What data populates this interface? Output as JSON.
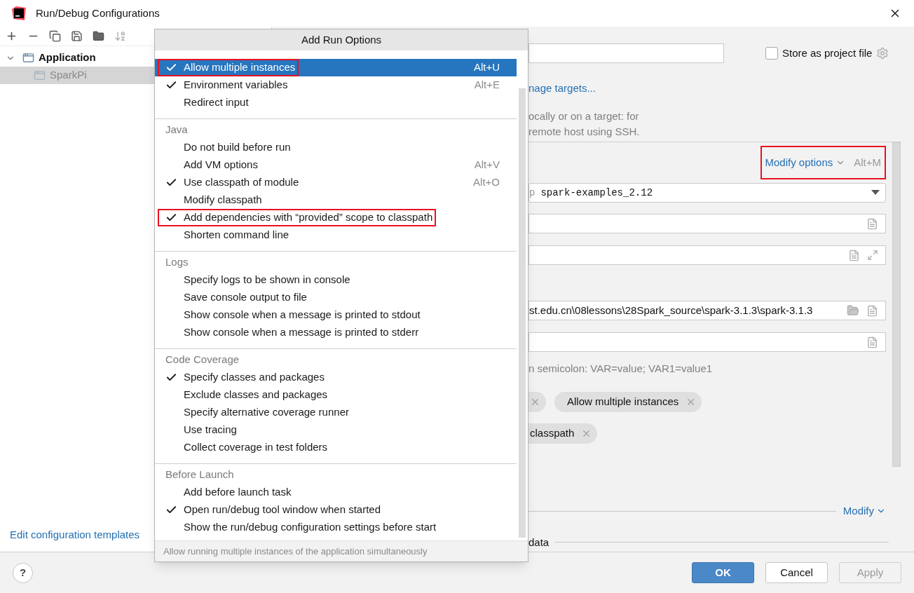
{
  "window": {
    "title": "Run/Debug Configurations"
  },
  "left_panel": {
    "tree": [
      {
        "label": "Application",
        "expanded": true,
        "selected": false,
        "children": [
          {
            "label": "SparkPi",
            "selected": true
          }
        ]
      }
    ],
    "templates_link": "Edit configuration templates"
  },
  "popup": {
    "title": "Add Run Options",
    "sections": [
      {
        "items": [
          {
            "label": "Allow multiple instances",
            "checked": true,
            "selected": true,
            "highlighted": true,
            "shortcut": "Alt+U"
          },
          {
            "label": "Environment variables",
            "checked": true,
            "selected": false,
            "highlighted": false,
            "shortcut": "Alt+E"
          },
          {
            "label": "Redirect input",
            "checked": false,
            "selected": false,
            "highlighted": false
          }
        ]
      },
      {
        "label": "Java",
        "items": [
          {
            "label": "Do not build before run",
            "checked": false,
            "selected": false,
            "highlighted": false
          },
          {
            "label": "Add VM options",
            "checked": false,
            "selected": false,
            "highlighted": false,
            "shortcut": "Alt+V"
          },
          {
            "label": "Use classpath of module",
            "checked": true,
            "selected": false,
            "highlighted": false,
            "shortcut": "Alt+O"
          },
          {
            "label": "Modify classpath",
            "checked": false,
            "selected": false,
            "highlighted": false
          },
          {
            "label": "Add dependencies with “provided” scope to classpath",
            "checked": true,
            "selected": false,
            "highlighted": true
          },
          {
            "label": "Shorten command line",
            "checked": false,
            "selected": false,
            "highlighted": false
          }
        ]
      },
      {
        "label": "Logs",
        "items": [
          {
            "label": "Specify logs to be shown in console",
            "checked": false,
            "selected": false,
            "highlighted": false
          },
          {
            "label": "Save console output to file",
            "checked": false,
            "selected": false,
            "highlighted": false
          },
          {
            "label": "Show console when a message is printed to stdout",
            "checked": false,
            "selected": false,
            "highlighted": false
          },
          {
            "label": "Show console when a message is printed to stderr",
            "checked": false,
            "selected": false,
            "highlighted": false
          }
        ]
      },
      {
        "label": "Code Coverage",
        "items": [
          {
            "label": "Specify classes and packages",
            "checked": true,
            "selected": false,
            "highlighted": false
          },
          {
            "label": "Exclude classes and packages",
            "checked": false,
            "selected": false,
            "highlighted": false
          },
          {
            "label": "Specify alternative coverage runner",
            "checked": false,
            "selected": false,
            "highlighted": false
          },
          {
            "label": "Use tracing",
            "checked": false,
            "selected": false,
            "highlighted": false
          },
          {
            "label": "Collect coverage in test folders",
            "checked": false,
            "selected": false,
            "highlighted": false
          }
        ]
      },
      {
        "label": "Before Launch",
        "items": [
          {
            "label": "Add before launch task",
            "checked": false,
            "selected": false,
            "highlighted": false
          },
          {
            "label": "Open run/debug tool window when started",
            "checked": true,
            "selected": false,
            "highlighted": false
          },
          {
            "label": "Show the run/debug configuration settings before start",
            "checked": false,
            "selected": false,
            "highlighted": false
          }
        ]
      }
    ],
    "hint": "Allow running multiple instances of the application simultaneously"
  },
  "config": {
    "store_as_project_file": {
      "label": "Store as project file",
      "checked": false
    },
    "targets_link": "nage targets...",
    "description": [
      "ocally or on a target: for",
      "remote host using SSH."
    ],
    "modify_options": {
      "label": "Modify options",
      "shortcut": "Alt+M",
      "highlighted": true
    },
    "fields": [
      {
        "kind": "combo",
        "prefix": "p",
        "value": "spark-examples_2.12"
      },
      {
        "kind": "text"
      },
      {
        "kind": "expandable"
      },
      {
        "kind": "path",
        "value": "st.edu.cn\\08lessons\\28Spark_source\\spark-3.1.3\\spark-3.1.3"
      },
      {
        "kind": "text"
      }
    ],
    "env_hint": "n semicolon: VAR=value; VAR1=value1",
    "chip_rows": [
      [
        {
          "kind": "cut"
        },
        {
          "kind": "full",
          "label": "Allow multiple instances"
        }
      ],
      [
        {
          "kind": "cut",
          "label": "classpath"
        }
      ]
    ],
    "modify_link": "Modify",
    "data_label": "data"
  },
  "footer": {
    "help": "?",
    "buttons": [
      {
        "label": "OK",
        "kind": "primary"
      },
      {
        "label": "Cancel",
        "kind": "default"
      },
      {
        "label": "Apply",
        "kind": "disabled"
      }
    ]
  }
}
